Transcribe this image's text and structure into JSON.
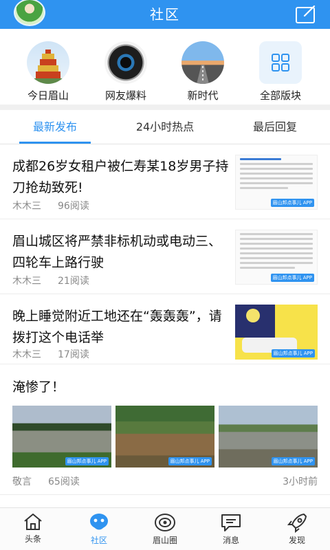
{
  "header": {
    "title": "社区"
  },
  "boards": [
    {
      "label": "今日眉山",
      "icon": "tower-icon"
    },
    {
      "label": "网友爆料",
      "icon": "camera-lens-icon"
    },
    {
      "label": "新时代",
      "icon": "road-icon"
    },
    {
      "label": "全部版块",
      "icon": "grid-icon"
    }
  ],
  "tabs": [
    {
      "label": "最新发布",
      "active": true
    },
    {
      "label": "24小时热点",
      "active": false
    },
    {
      "label": "最后回复",
      "active": false
    }
  ],
  "posts": [
    {
      "title": "成都26岁女租户被仁寿某18岁男子持刀抢劫致死!",
      "author": "木木三",
      "reads": "96阅读"
    },
    {
      "title": "眉山城区将严禁非标机动或电动三、四轮车上路行驶",
      "author": "木木三",
      "reads": "21阅读"
    },
    {
      "title": "晚上睡觉附近工地还在“轰轰轰”，请拨打这个电话举",
      "author": "木木三",
      "reads": "17阅读"
    },
    {
      "title": "淹惨了！",
      "author": "敬言",
      "reads": "65阅读",
      "time": "3小时前"
    }
  ],
  "watermark": "眉山邦点事儿 APP",
  "nav": [
    {
      "label": "头条",
      "icon": "home-icon",
      "active": false
    },
    {
      "label": "社区",
      "icon": "community-icon",
      "active": true
    },
    {
      "label": "眉山圈",
      "icon": "circle-eye-icon",
      "active": false
    },
    {
      "label": "消息",
      "icon": "message-icon",
      "active": false
    },
    {
      "label": "发现",
      "icon": "rocket-icon",
      "active": false
    }
  ],
  "colors": {
    "accent": "#2f93f0",
    "text": "#111111",
    "muted": "#888888"
  }
}
